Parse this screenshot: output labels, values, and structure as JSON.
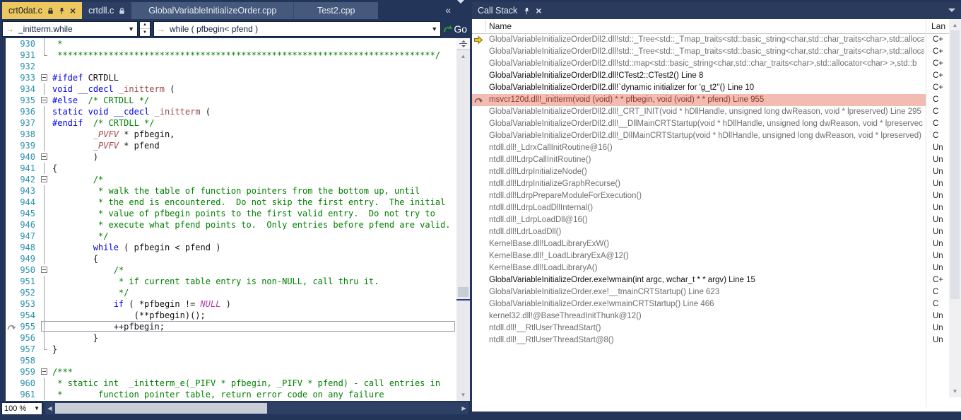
{
  "colors": {
    "active_tab_gold": "#EDC85E",
    "selected_frame_bg": "#F2BCB2",
    "selected_frame_text": "#8E3A2E",
    "current_statement_yellow": "#F2C811",
    "go_arrow_green": "#3FA046",
    "nav_arrow_orange": "#C08A1E",
    "line_number_teal": "#2B91AF",
    "keyword_blue": "#0000EE",
    "comment_green": "#008000",
    "type_maroon": "#9E4B4B",
    "macro_purple": "#B43CB4"
  },
  "editor_tabs": [
    {
      "label": "crt0dat.c",
      "state": "active"
    },
    {
      "label": "crtdll.c",
      "state": "inactive"
    },
    {
      "label": "GlobalVariableInitializeOrder.cpp",
      "state": "inactive"
    },
    {
      "label": "Test2.cpp",
      "state": "inactive"
    }
  ],
  "navbar": {
    "scope": "_initterm.while",
    "member": "while ( pfbegin< pfend )",
    "go_label": "Go"
  },
  "editor": {
    "zoom_value": "100 %",
    "current_line": 955,
    "lines": [
      {
        "n": 930,
        "g": "l",
        "s": [
          [
            "c",
            " *"
          ]
        ]
      },
      {
        "n": 931,
        "g": "e",
        "s": [
          [
            "c",
            " **************************************************************************/"
          ]
        ]
      },
      {
        "n": 932,
        "g": "",
        "s": []
      },
      {
        "n": 933,
        "g": "b",
        "s": [
          [
            "p",
            "#ifdef "
          ],
          [
            "x",
            "CRTDLL"
          ]
        ]
      },
      {
        "n": 934,
        "g": "l",
        "s": [
          [
            "k",
            "void"
          ],
          [
            "x",
            " "
          ],
          [
            "k",
            "__cdecl"
          ],
          [
            "x",
            " "
          ],
          [
            "f",
            "_initterm"
          ],
          [
            "x",
            " ("
          ]
        ]
      },
      {
        "n": 935,
        "g": "b",
        "s": [
          [
            "p",
            "#else"
          ],
          [
            "x",
            "  "
          ],
          [
            "c",
            "/* CRTDLL */"
          ]
        ]
      },
      {
        "n": 936,
        "g": "l",
        "s": [
          [
            "k",
            "static"
          ],
          [
            "x",
            " "
          ],
          [
            "k",
            "void"
          ],
          [
            "x",
            " "
          ],
          [
            "k",
            "__cdecl"
          ],
          [
            "x",
            " "
          ],
          [
            "f",
            "_initterm"
          ],
          [
            "x",
            " ("
          ]
        ]
      },
      {
        "n": 937,
        "g": "l",
        "s": [
          [
            "p",
            "#endif"
          ],
          [
            "x",
            "  "
          ],
          [
            "c",
            "/* CRTDLL */"
          ]
        ]
      },
      {
        "n": 938,
        "g": "l",
        "s": [
          [
            "x",
            "        "
          ],
          [
            "t",
            "_PVFV"
          ],
          [
            "x",
            " * pfbegin,"
          ]
        ]
      },
      {
        "n": 939,
        "g": "l",
        "s": [
          [
            "x",
            "        "
          ],
          [
            "t",
            "_PVFV"
          ],
          [
            "x",
            " * pfend"
          ]
        ]
      },
      {
        "n": 940,
        "g": "b",
        "s": [
          [
            "x",
            "        )"
          ]
        ]
      },
      {
        "n": 941,
        "g": "l",
        "s": [
          [
            "x",
            "{"
          ]
        ]
      },
      {
        "n": 942,
        "g": "b",
        "s": [
          [
            "x",
            "        "
          ],
          [
            "c",
            "/*"
          ]
        ]
      },
      {
        "n": 943,
        "g": "l",
        "s": [
          [
            "c",
            "         * walk the table of function pointers from the bottom up, until"
          ]
        ]
      },
      {
        "n": 944,
        "g": "l",
        "s": [
          [
            "c",
            "         * the end is encountered.  Do not skip the first entry.  The initial"
          ]
        ]
      },
      {
        "n": 945,
        "g": "l",
        "s": [
          [
            "c",
            "         * value of pfbegin points to the first valid entry.  Do not try to"
          ]
        ]
      },
      {
        "n": 946,
        "g": "l",
        "s": [
          [
            "c",
            "         * execute what pfend points to.  Only entries before pfend are valid."
          ]
        ]
      },
      {
        "n": 947,
        "g": "l",
        "s": [
          [
            "c",
            "         */"
          ]
        ]
      },
      {
        "n": 948,
        "g": "l",
        "s": [
          [
            "x",
            "        "
          ],
          [
            "k",
            "while"
          ],
          [
            "x",
            " ( pfbegin < pfend )"
          ]
        ]
      },
      {
        "n": 949,
        "g": "l",
        "s": [
          [
            "x",
            "        {"
          ]
        ]
      },
      {
        "n": 950,
        "g": "b",
        "s": [
          [
            "x",
            "            "
          ],
          [
            "c",
            "/*"
          ]
        ]
      },
      {
        "n": 951,
        "g": "l",
        "s": [
          [
            "c",
            "             * if current table entry is non-NULL, call thru it."
          ]
        ]
      },
      {
        "n": 952,
        "g": "l",
        "s": [
          [
            "c",
            "             */"
          ]
        ]
      },
      {
        "n": 953,
        "g": "l",
        "s": [
          [
            "x",
            "            "
          ],
          [
            "k",
            "if"
          ],
          [
            "x",
            " ( *pfbegin != "
          ],
          [
            "m",
            "NULL"
          ],
          [
            "x",
            " )"
          ]
        ]
      },
      {
        "n": 954,
        "g": "l",
        "s": [
          [
            "x",
            "                (**pfbegin)();"
          ]
        ]
      },
      {
        "n": 955,
        "g": "l",
        "s": [
          [
            "x",
            "            ++pfbegin;"
          ]
        ]
      },
      {
        "n": 956,
        "g": "l",
        "s": [
          [
            "x",
            "        }"
          ]
        ]
      },
      {
        "n": 957,
        "g": "e",
        "s": [
          [
            "x",
            "}"
          ]
        ]
      },
      {
        "n": 958,
        "g": "",
        "s": []
      },
      {
        "n": 959,
        "g": "b",
        "s": [
          [
            "c",
            "/***"
          ]
        ]
      },
      {
        "n": 960,
        "g": "l",
        "s": [
          [
            "c",
            " * static int  _initterm_e(_PIFV * pfbegin, _PIFV * pfend) - call entries in"
          ]
        ]
      },
      {
        "n": 961,
        "g": "l",
        "s": [
          [
            "c",
            " *       function pointer table, return error code on any failure"
          ]
        ]
      }
    ]
  },
  "callstack": {
    "title": "Call Stack",
    "col_name": "Name",
    "col_lang": "Lan",
    "frames": [
      {
        "icon": "current-statement",
        "tone": "dim",
        "lang": "C+",
        "name": "GlobalVariableInitializeOrderDll2.dll!std::_Tree<std::_Tmap_traits<std::basic_string<char,std::char_traits<char>,std::alloca"
      },
      {
        "icon": "",
        "tone": "dim",
        "lang": "C+",
        "name": "GlobalVariableInitializeOrderDll2.dll!std::_Tree<std::_Tmap_traits<std::basic_string<char,std::char_traits<char>,std::alloca"
      },
      {
        "icon": "",
        "tone": "dim",
        "lang": "C+",
        "name": "GlobalVariableInitializeOrderDll2.dll!std::map<std::basic_string<char,std::char_traits<char>,std::allocator<char> >,std::b"
      },
      {
        "icon": "",
        "tone": "user",
        "lang": "C+",
        "name": "GlobalVariableInitializeOrderDll2.dll!CTest2::CTest2() Line 8"
      },
      {
        "icon": "",
        "tone": "user",
        "lang": "C+",
        "name": "GlobalVariableInitializeOrderDll2.dll!`dynamic initializer for 'g_t2''() Line 10"
      },
      {
        "icon": "selected-frame",
        "tone": "selected",
        "lang": "C",
        "name": "msvcr120d.dll!_initterm(void (void) * * pfbegin, void (void) * * pfend) Line 955"
      },
      {
        "icon": "",
        "tone": "dim",
        "lang": "C",
        "name": "GlobalVariableInitializeOrderDll2.dll!_CRT_INIT(void * hDllHandle, unsigned long dwReason, void * lpreserved) Line 295"
      },
      {
        "icon": "",
        "tone": "dim",
        "lang": "C",
        "name": "GlobalVariableInitializeOrderDll2.dll!__DllMainCRTStartup(void * hDllHandle, unsigned long dwReason, void * lpreservec"
      },
      {
        "icon": "",
        "tone": "dim",
        "lang": "C",
        "name": "GlobalVariableInitializeOrderDll2.dll!_DllMainCRTStartup(void * hDllHandle, unsigned long dwReason, void * lpreserved)"
      },
      {
        "icon": "",
        "tone": "dim",
        "lang": "Un",
        "name": "ntdll.dll!_LdrxCallInitRoutine@16()"
      },
      {
        "icon": "",
        "tone": "dim",
        "lang": "Un",
        "name": "ntdll.dll!LdrpCallInitRoutine()"
      },
      {
        "icon": "",
        "tone": "dim",
        "lang": "Un",
        "name": "ntdll.dll!LdrpInitializeNode()"
      },
      {
        "icon": "",
        "tone": "dim",
        "lang": "Un",
        "name": "ntdll.dll!LdrpInitializeGraphRecurse()"
      },
      {
        "icon": "",
        "tone": "dim",
        "lang": "Un",
        "name": "ntdll.dll!LdrpPrepareModuleForExecution()"
      },
      {
        "icon": "",
        "tone": "dim",
        "lang": "Un",
        "name": "ntdll.dll!LdrpLoadDllInternal()"
      },
      {
        "icon": "",
        "tone": "dim",
        "lang": "Un",
        "name": "ntdll.dll!_LdrpLoadDll@16()"
      },
      {
        "icon": "",
        "tone": "dim",
        "lang": "Un",
        "name": "ntdll.dll!LdrLoadDll()"
      },
      {
        "icon": "",
        "tone": "dim",
        "lang": "Un",
        "name": "KernelBase.dll!LoadLibraryExW()"
      },
      {
        "icon": "",
        "tone": "dim",
        "lang": "Un",
        "name": "KernelBase.dll!_LoadLibraryExA@12()"
      },
      {
        "icon": "",
        "tone": "dim",
        "lang": "Un",
        "name": "KernelBase.dll!LoadLibraryA()"
      },
      {
        "icon": "",
        "tone": "user",
        "lang": "C+",
        "name": "GlobalVariableInitializeOrder.exe!wmain(int argc, wchar_t * * argv) Line 15"
      },
      {
        "icon": "",
        "tone": "dim",
        "lang": "C",
        "name": "GlobalVariableInitializeOrder.exe!__tmainCRTStartup() Line 623"
      },
      {
        "icon": "",
        "tone": "dim",
        "lang": "C",
        "name": "GlobalVariableInitializeOrder.exe!wmainCRTStartup() Line 466"
      },
      {
        "icon": "",
        "tone": "dim",
        "lang": "Un",
        "name": "kernel32.dll!@BaseThreadInitThunk@12()"
      },
      {
        "icon": "",
        "tone": "dim",
        "lang": "Un",
        "name": "ntdll.dll!__RtlUserThreadStart()"
      },
      {
        "icon": "",
        "tone": "dim",
        "lang": "Un",
        "name": "ntdll.dll!__RtlUserThreadStart@8()"
      }
    ]
  }
}
